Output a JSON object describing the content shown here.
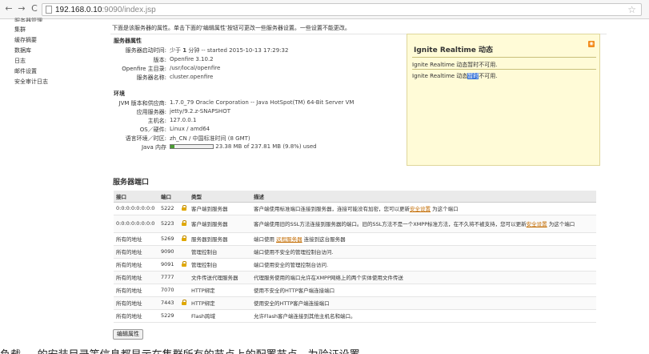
{
  "browser": {
    "url_host": "192.168.0.10",
    "url_rest": ":9090/index.jsp",
    "back_icon": "back-arrow-icon",
    "forward_icon": "forward-arrow-icon",
    "reload_icon": "reload-icon",
    "star_icon": "bookmark-star-icon"
  },
  "sidebar": {
    "cut_item": "服务器管理",
    "items": [
      {
        "label": "集群"
      },
      {
        "label": "缓存摘要"
      },
      {
        "label": "数据库"
      },
      {
        "label": "日志"
      },
      {
        "label": "邮件设置"
      },
      {
        "label": "安全审计日志"
      }
    ]
  },
  "main": {
    "intro": "下面是该服务器的属性。单击下面的'编辑属性'按钮可更改一些服务器设置。一些设置不能更改。",
    "server_props": {
      "heading": "服务器属性",
      "rows": [
        {
          "k": "服务器启动时间:",
          "v_pre": "少于 ",
          "v_bold": "1",
          "v_post": " 分钟 -- started 2015-10-13 17:29:32"
        },
        {
          "k": "版本:",
          "v": "Openfire 3.10.2"
        },
        {
          "k": "Openfire 主目录:",
          "v": "/usr/local/openfire"
        },
        {
          "k": "服务器名称:",
          "v": "cluster.openfire"
        }
      ]
    },
    "env": {
      "heading": "环境",
      "rows": [
        {
          "k": "JVM 版本和供应商:",
          "v": "1.7.0_79 Oracle Corporation -- Java HotSpot(TM) 64-Bit Server VM"
        },
        {
          "k": "应用服务器:",
          "v": "jetty/9.2.z-SNAPSHOT"
        },
        {
          "k": "主机名:",
          "v": "127.0.0.1"
        },
        {
          "k": "OS／硬件:",
          "v": "Linux / amd64"
        },
        {
          "k": "语言环境／时区:",
          "v": "zh_CN / 中国标准时间 (8 GMT)"
        }
      ],
      "java_mem_label": "Java 内存",
      "java_mem_text": "23.38 MB of 237.81 MB (9.8%) used",
      "java_mem_fraction": 0.098
    },
    "news": {
      "title": "Ignite Realtime 动态",
      "rss_icon": "rss-feed-icon",
      "line1": "Ignite Realtime 动态暂时不可用.",
      "line2_a": "Ignite Realtime 动态",
      "line2_hl": "暂时",
      "line2_b": "不可用."
    },
    "ports": {
      "title": "服务器端口",
      "headers": [
        "接口",
        "端口",
        "",
        "类型",
        "描述"
      ],
      "rows": [
        {
          "iface": "0:0:0:0:0:0:0:0",
          "port": "5222",
          "lock": true,
          "type": "客户端到服务器",
          "d1": "客户端使用标准端口连接到服务器，连接可能没有加密，您可以更新",
          "link": "安全设置",
          "d2": " 为这个端口"
        },
        {
          "iface": "0:0:0:0:0:0:0:0",
          "port": "5223",
          "lock": true,
          "type": "客户端到服务器",
          "d1": "客户端使用旧的SSL方法连接到服务器的端口。旧的SSL方法不是一个XMPP标准方法，在不久将不被支持，您可以更新",
          "link": "安全设置",
          "d2": " 为这个端口"
        },
        {
          "iface": "所有的地址",
          "port": "5269",
          "lock": true,
          "type": "服务器到服务器",
          "d1": "端口使用 ",
          "link": "远程服务器",
          "d2": " 连接到这台服务器"
        },
        {
          "iface": "所有的地址",
          "port": "9090",
          "lock": false,
          "type": "管理控制台",
          "d1": "端口使用不安全的管理控制台访问.",
          "link": "",
          "d2": ""
        },
        {
          "iface": "所有的地址",
          "port": "9091",
          "lock": true,
          "type": "管理控制台",
          "d1": "端口使用安全的管理控制台访问.",
          "link": "",
          "d2": ""
        },
        {
          "iface": "所有的地址",
          "port": "7777",
          "lock": false,
          "type": "文件传送代理服务器",
          "d1": "代理服务使用的端口允许在XMPP网络上的两个实体使用文件传送",
          "link": "",
          "d2": ""
        },
        {
          "iface": "所有的地址",
          "port": "7070",
          "lock": false,
          "type": "HTTP绑定",
          "d1": "使用不安全的HTTP客户端连接端口",
          "link": "",
          "d2": ""
        },
        {
          "iface": "所有的地址",
          "port": "7443",
          "lock": true,
          "type": "HTTP绑定",
          "d1": "使用安全的HTTP客户端连接端口",
          "link": "",
          "d2": ""
        },
        {
          "iface": "所有的地址",
          "port": "5229",
          "lock": false,
          "type": "Flash跨域",
          "d1": "允许Flash客户端连接到其他主机名和端口。",
          "link": "",
          "d2": ""
        }
      ]
    },
    "edit_button": "编辑属性"
  },
  "overlay_text": "负载 ... 的安装目录等信息都显示在集群所有的节点上的配置节点，为验证设置"
}
